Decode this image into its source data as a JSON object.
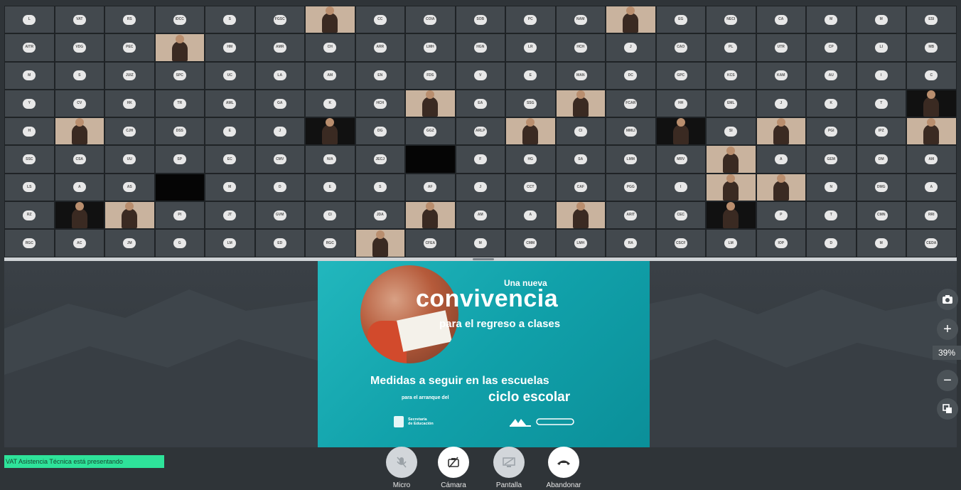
{
  "participants": [
    {
      "i": "L"
    },
    {
      "i": "VAT"
    },
    {
      "i": "RS"
    },
    {
      "i": "IDCC"
    },
    {
      "i": "S"
    },
    {
      "i": "FGSC"
    },
    {
      "video": true
    },
    {
      "i": "CC"
    },
    {
      "i": "COIA"
    },
    {
      "i": "SOB"
    },
    {
      "i": "PC"
    },
    {
      "i": "NAM"
    },
    {
      "video": true
    },
    {
      "i": "EG"
    },
    {
      "i": "NECI"
    },
    {
      "i": "CA"
    },
    {
      "i": "M"
    },
    {
      "i": "M"
    },
    {
      "i": "ESI"
    },
    {
      "i": "AITR"
    },
    {
      "i": "VDG"
    },
    {
      "i": "PEC"
    },
    {
      "video": true
    },
    {
      "i": "HM"
    },
    {
      "i": "AMR"
    },
    {
      "i": "CH"
    },
    {
      "i": "ARR"
    },
    {
      "i": "LMH"
    },
    {
      "i": "HGN"
    },
    {
      "i": "LR"
    },
    {
      "i": "HCH"
    },
    {
      "i": "J"
    },
    {
      "i": "CAO"
    },
    {
      "i": "PL"
    },
    {
      "i": "UTR"
    },
    {
      "i": "CP"
    },
    {
      "i": "LI"
    },
    {
      "i": "MB"
    },
    {
      "i": "M"
    },
    {
      "i": "S"
    },
    {
      "i": "JUIZ"
    },
    {
      "i": "SPC"
    },
    {
      "i": "UC"
    },
    {
      "i": "LA"
    },
    {
      "i": "AM"
    },
    {
      "i": "EN"
    },
    {
      "i": "FDS"
    },
    {
      "i": "V"
    },
    {
      "i": "E"
    },
    {
      "i": "MAN"
    },
    {
      "i": "DC"
    },
    {
      "i": "GPC"
    },
    {
      "i": "KCS"
    },
    {
      "i": "KAM"
    },
    {
      "i": "AU"
    },
    {
      "i": "I"
    },
    {
      "i": "C"
    },
    {
      "i": "Y"
    },
    {
      "i": "CV"
    },
    {
      "i": "HK"
    },
    {
      "i": "TR"
    },
    {
      "i": "AML"
    },
    {
      "i": "GA"
    },
    {
      "i": "K"
    },
    {
      "i": "HCH"
    },
    {
      "video": true
    },
    {
      "i": "EA"
    },
    {
      "i": "SSG"
    },
    {
      "video": true
    },
    {
      "i": "FCAR"
    },
    {
      "i": "HH"
    },
    {
      "i": "EML"
    },
    {
      "i": "J"
    },
    {
      "i": "K"
    },
    {
      "i": "T"
    },
    {
      "video": true,
      "dark": true
    },
    {
      "i": "H"
    },
    {
      "video": true
    },
    {
      "i": "CJH"
    },
    {
      "i": "DSS"
    },
    {
      "i": "E"
    },
    {
      "i": "J"
    },
    {
      "video": true,
      "dark": true
    },
    {
      "i": "DG"
    },
    {
      "i": "GGZ"
    },
    {
      "i": "ARLP"
    },
    {
      "video": true
    },
    {
      "i": "CI"
    },
    {
      "i": "MMLI"
    },
    {
      "video": true,
      "dark": true
    },
    {
      "i": "SI"
    },
    {
      "video": true
    },
    {
      "i": "PGI"
    },
    {
      "i": "IPZ"
    },
    {
      "video": true
    },
    {
      "i": "SSC"
    },
    {
      "i": "CSA"
    },
    {
      "i": "UU"
    },
    {
      "i": "SP"
    },
    {
      "i": "EC"
    },
    {
      "i": "CMV"
    },
    {
      "i": "N/A"
    },
    {
      "i": "JECJ"
    },
    {
      "black": true
    },
    {
      "i": "F"
    },
    {
      "i": "HG"
    },
    {
      "i": "SA"
    },
    {
      "i": "LMM"
    },
    {
      "i": "MRV"
    },
    {
      "video": true
    },
    {
      "i": "A"
    },
    {
      "i": "GEM"
    },
    {
      "i": "DM"
    },
    {
      "i": "AM"
    },
    {
      "i": "LS"
    },
    {
      "i": "A"
    },
    {
      "i": "AS"
    },
    {
      "black": true
    },
    {
      "i": "M"
    },
    {
      "i": "D"
    },
    {
      "i": "E"
    },
    {
      "i": "S"
    },
    {
      "i": "AF"
    },
    {
      "i": "J"
    },
    {
      "i": "CCT"
    },
    {
      "i": "CAF"
    },
    {
      "i": "PGG"
    },
    {
      "i": "I"
    },
    {
      "video": true
    },
    {
      "video": true
    },
    {
      "i": "N"
    },
    {
      "i": "DMG"
    },
    {
      "i": "A"
    },
    {
      "i": "RZ"
    },
    {
      "video": true,
      "dark": true
    },
    {
      "video": true
    },
    {
      "i": "PI"
    },
    {
      "i": "JT"
    },
    {
      "i": "GVM"
    },
    {
      "i": "CI"
    },
    {
      "i": "JDA"
    },
    {
      "video": true
    },
    {
      "i": "AM"
    },
    {
      "i": "A"
    },
    {
      "video": true
    },
    {
      "i": "ARIT"
    },
    {
      "i": "CEC"
    },
    {
      "video": true,
      "dark": true
    },
    {
      "i": "P"
    },
    {
      "i": "T"
    },
    {
      "i": "CMN"
    },
    {
      "i": "RRI"
    },
    {
      "i": "RGC"
    },
    {
      "i": "AC"
    },
    {
      "i": "JM"
    },
    {
      "i": "G"
    },
    {
      "i": "LM"
    },
    {
      "i": "ED"
    },
    {
      "i": "RGC"
    },
    {
      "video": true
    },
    {
      "i": "CFEA"
    },
    {
      "i": "M"
    },
    {
      "i": "CMM"
    },
    {
      "i": "LMH"
    },
    {
      "i": "RA"
    },
    {
      "i": "CSCF"
    },
    {
      "i": "LM"
    },
    {
      "i": "IOP"
    },
    {
      "i": "D"
    },
    {
      "i": "M"
    },
    {
      "i": "CEDA"
    }
  ],
  "slide": {
    "line1": "Una nueva",
    "line2": "convivencia",
    "line3": "para el regreso a clases",
    "line4": "Medidas a seguir en las escuelas",
    "line5a": "para el arranque del",
    "line5b": "ciclo escolar",
    "logo_left": "Secretaría\nde Educación",
    "logo_right": ""
  },
  "tools": {
    "camera_icon": "camera-icon",
    "zoom_in_icon": "plus-icon",
    "zoom_level": "39%",
    "zoom_out_icon": "minus-icon",
    "copy_icon": "copy-icon"
  },
  "presenter_notice": "VAT Asistencia Técnica está presentando",
  "controls": {
    "mic": {
      "label": "Micro",
      "icon": "mic-off-icon"
    },
    "camera": {
      "label": "Cámara",
      "icon": "camera-off-icon"
    },
    "screen": {
      "label": "Pantalla",
      "icon": "screen-share-icon"
    },
    "leave": {
      "label": "Abandonar",
      "icon": "hang-up-icon"
    }
  },
  "colors": {
    "background": "#2f3438",
    "slide_teal": "#11a1aa",
    "presenter_green": "#2ee39a"
  }
}
